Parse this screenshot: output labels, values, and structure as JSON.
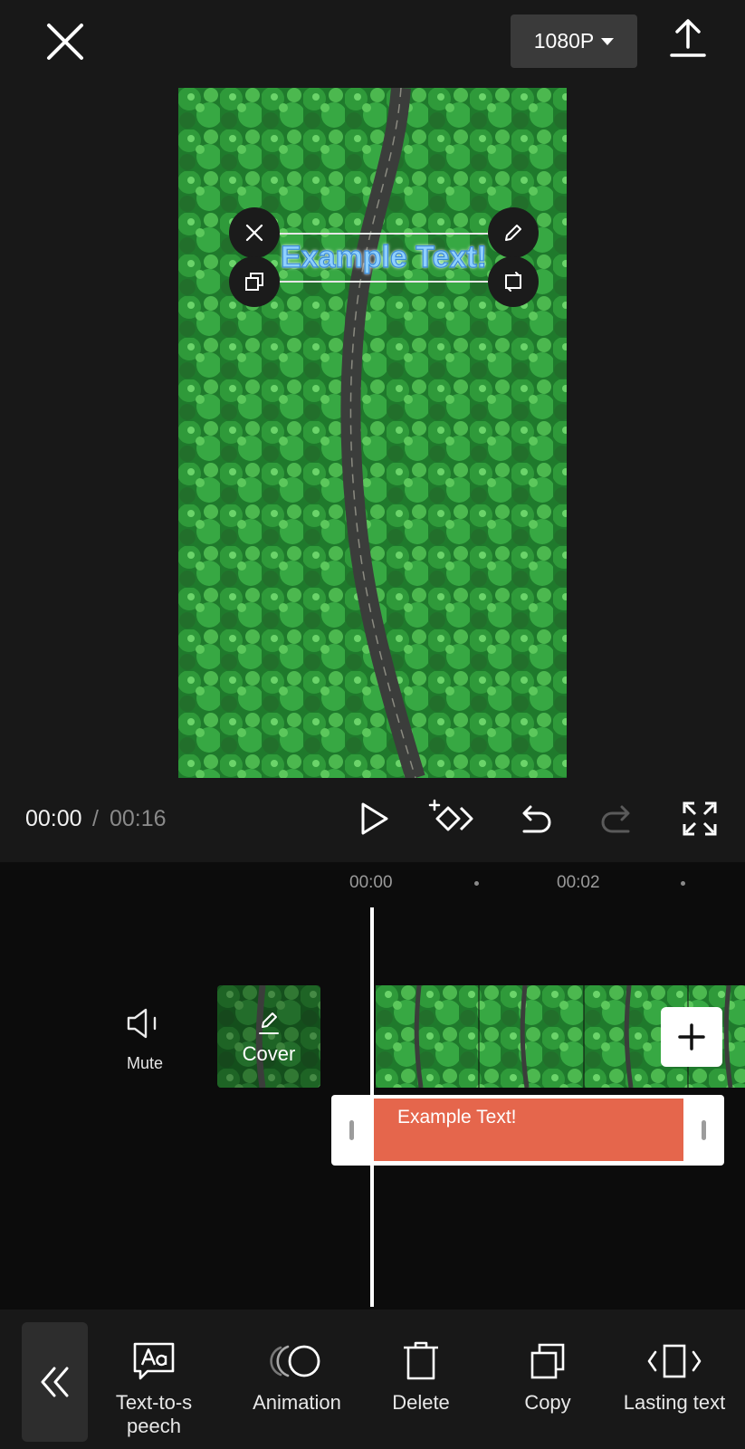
{
  "header": {
    "close_icon": "close-icon",
    "resolution": "1080P",
    "export_icon": "upload-icon"
  },
  "preview": {
    "overlay_text": "Example Text!",
    "handles": [
      "close-icon",
      "edit-pencil-icon",
      "duplicate-icon",
      "rotate-scale-icon"
    ]
  },
  "playback": {
    "current_time": "00:00",
    "separator": "/",
    "total_time": "00:16"
  },
  "timeline": {
    "ticks": [
      "00:00",
      "00:02"
    ],
    "mute_label": "Mute",
    "cover_label": "Cover",
    "text_clip_label": "Example Text!",
    "add_clip_icon": "plus-icon"
  },
  "toolbar": {
    "items": [
      {
        "label": "Text-to-s\npeech",
        "icon": "text-to-speech-icon"
      },
      {
        "label": "Animation",
        "icon": "animation-icon"
      },
      {
        "label": "Delete",
        "icon": "delete-icon"
      },
      {
        "label": "Copy",
        "icon": "copy-icon"
      },
      {
        "label": "Lasting text",
        "icon": "lasting-text-icon"
      }
    ]
  },
  "colors": {
    "background": "#181818",
    "timeline_bg": "#0c0c0c",
    "text_clip": "#e5664c",
    "overlay_text": "#8fd0ff"
  }
}
